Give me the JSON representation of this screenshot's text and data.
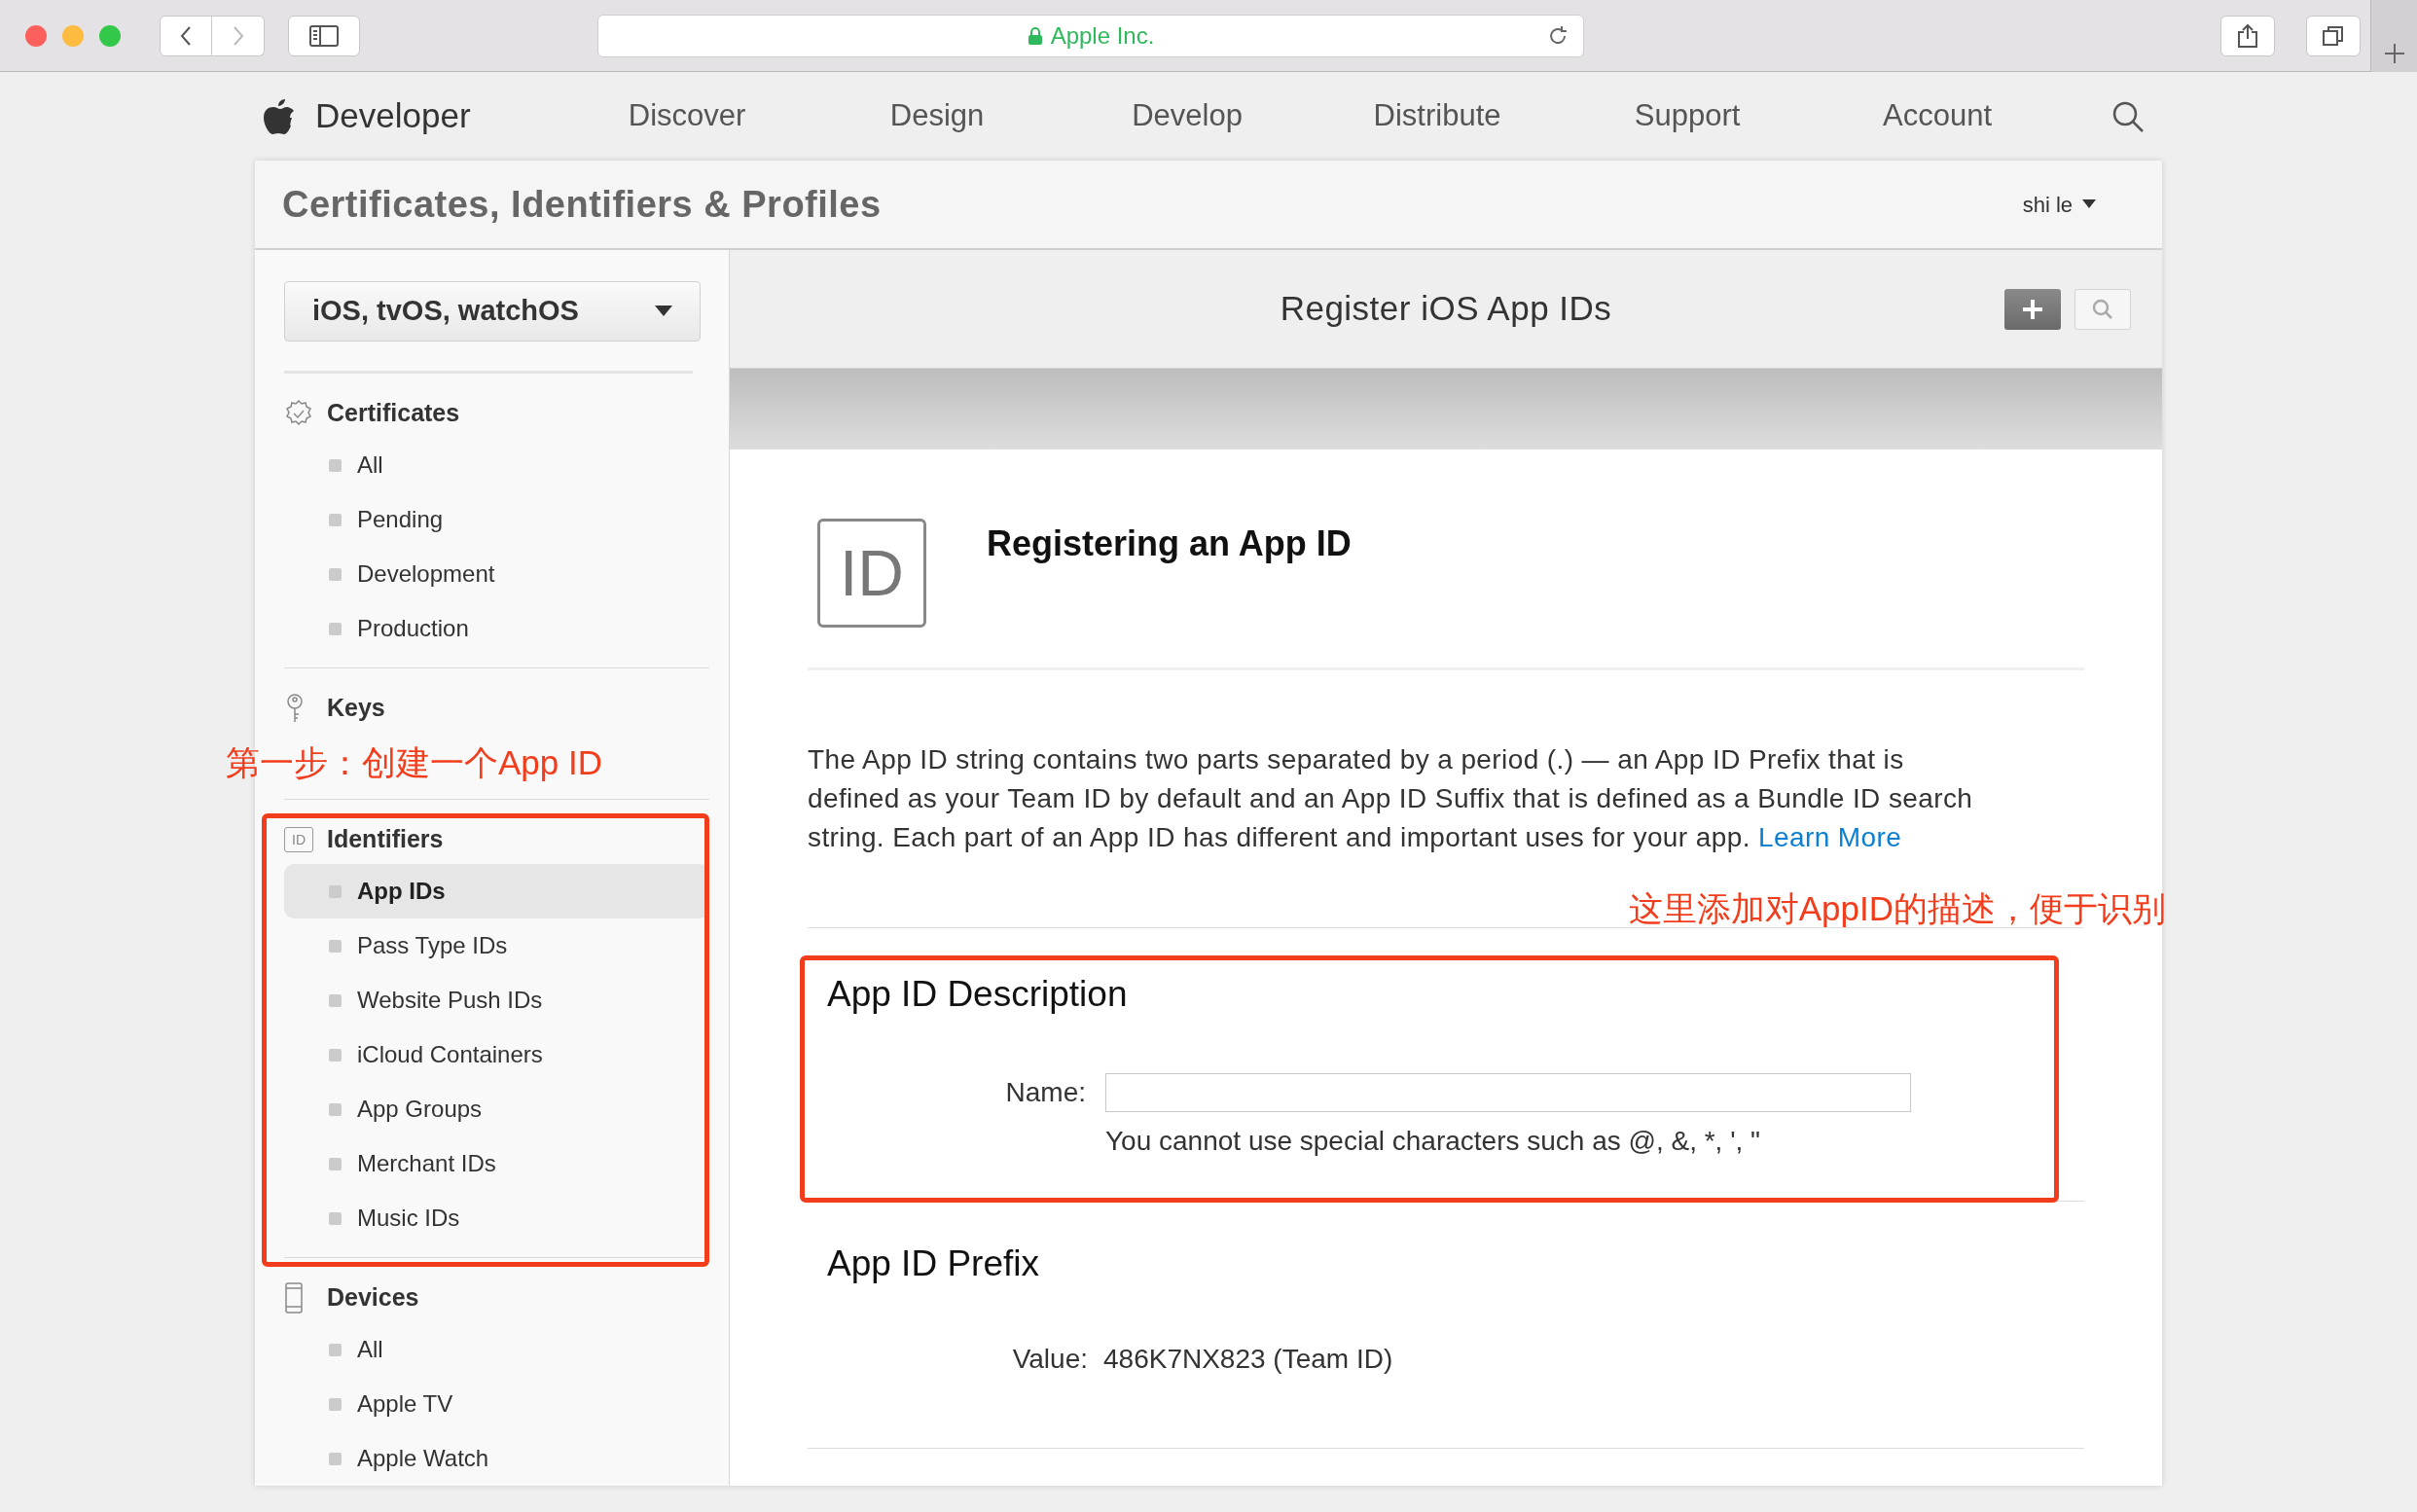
{
  "browser": {
    "address": "Apple Inc.",
    "secure": true
  },
  "nav": {
    "brand": "Developer",
    "items": [
      "Discover",
      "Design",
      "Develop",
      "Distribute",
      "Support",
      "Account"
    ]
  },
  "header": {
    "title": "Certificates, Identifiers & Profiles",
    "user": "shi le"
  },
  "sidebar": {
    "platform": "iOS, tvOS, watchOS",
    "sections": [
      {
        "kind": "certificates",
        "title": "Certificates",
        "items": [
          {
            "label": "All",
            "selected": false
          },
          {
            "label": "Pending",
            "selected": false
          },
          {
            "label": "Development",
            "selected": false
          },
          {
            "label": "Production",
            "selected": false
          }
        ]
      },
      {
        "kind": "keys",
        "title": "Keys"
      },
      {
        "kind": "identifiers",
        "title": "Identifiers",
        "badge": "ID",
        "items": [
          {
            "label": "App IDs",
            "selected": true
          },
          {
            "label": "Pass Type IDs",
            "selected": false
          },
          {
            "label": "Website Push IDs",
            "selected": false
          },
          {
            "label": "iCloud Containers",
            "selected": false
          },
          {
            "label": "App Groups",
            "selected": false
          },
          {
            "label": "Merchant IDs",
            "selected": false
          },
          {
            "label": "Music IDs",
            "selected": false
          }
        ]
      },
      {
        "kind": "devices",
        "title": "Devices",
        "items": [
          {
            "label": "All",
            "selected": false
          },
          {
            "label": "Apple TV",
            "selected": false
          },
          {
            "label": "Apple Watch",
            "selected": false
          }
        ]
      }
    ]
  },
  "main": {
    "title": "Register iOS App IDs",
    "intro": {
      "badge": "ID",
      "title": "Registering an App ID",
      "text": "The App ID string contains two parts separated by a period (.) — an App ID Prefix that is defined as your Team ID by default and an App ID Suffix that is defined as a Bundle ID search string. Each part of an App ID has different and important uses for your app.",
      "link": "Learn More"
    },
    "description": {
      "title": "App ID Description",
      "field_label": "Name:",
      "hint": "You cannot use special characters such as @, &, *, ', \""
    },
    "prefix": {
      "title": "App ID Prefix",
      "label": "Value:",
      "value": "486K7NX823 (Team ID)"
    }
  },
  "annotations": [
    {
      "text": "第一步：创建一个App ID"
    },
    {
      "text": "这里添加对AppID的描述，便于识别"
    }
  ]
}
